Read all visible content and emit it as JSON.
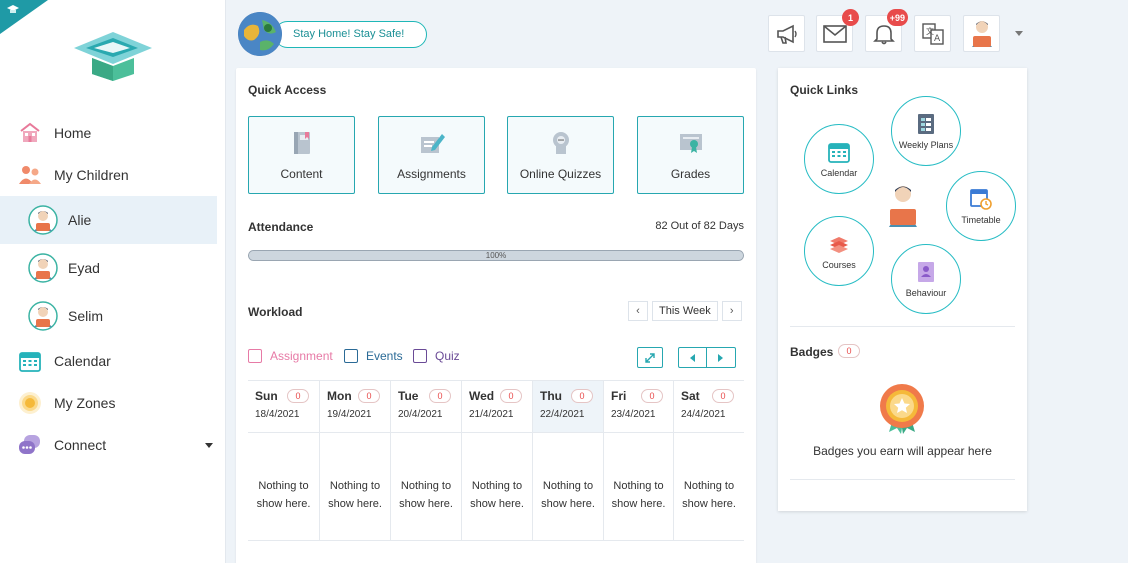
{
  "header": {
    "stay_home": "Stay Home! Stay Safe!",
    "messages_count": "1",
    "notifications_count": "+99"
  },
  "sidebar": {
    "items": [
      {
        "label": "Home",
        "icon": "home-icon"
      },
      {
        "label": "My Children",
        "icon": "children-icon"
      }
    ],
    "children": [
      {
        "label": "Alie",
        "active": true
      },
      {
        "label": "Eyad",
        "active": false
      },
      {
        "label": "Selim",
        "active": false
      }
    ],
    "items2": [
      {
        "label": "Calendar",
        "icon": "calendar-icon"
      },
      {
        "label": "My Zones",
        "icon": "zones-icon"
      },
      {
        "label": "Connect",
        "icon": "connect-icon"
      }
    ]
  },
  "main": {
    "quick_access_title": "Quick Access",
    "tiles": [
      {
        "label": "Content",
        "icon": "book-icon"
      },
      {
        "label": "Assignments",
        "icon": "assignment-icon"
      },
      {
        "label": "Online Quizzes",
        "icon": "quiz-icon"
      },
      {
        "label": "Grades",
        "icon": "certificate-icon"
      }
    ],
    "attendance_title": "Attendance",
    "attendance_summary": "82 Out of 82 Days",
    "attendance_percent_label": "100%",
    "attendance_fraction": 1.0,
    "workload_title": "Workload",
    "this_week": "This Week",
    "filters": [
      {
        "label": "Assignment",
        "color": "#e77aa6"
      },
      {
        "label": "Events",
        "color": "#2a6a96"
      },
      {
        "label": "Quiz",
        "color": "#6a4a96"
      }
    ],
    "days": [
      {
        "name": "Sun",
        "date": "18/4/2021",
        "count": "0",
        "empty1": "Nothing to",
        "empty2": "show here."
      },
      {
        "name": "Mon",
        "date": "19/4/2021",
        "count": "0",
        "empty1": "Nothing to",
        "empty2": "show here."
      },
      {
        "name": "Tue",
        "date": "20/4/2021",
        "count": "0",
        "empty1": "Nothing to",
        "empty2": "show here."
      },
      {
        "name": "Wed",
        "date": "21/4/2021",
        "count": "0",
        "empty1": "Nothing to",
        "empty2": "show here."
      },
      {
        "name": "Thu",
        "date": "22/4/2021",
        "count": "0",
        "empty1": "Nothing to",
        "empty2": "show here.",
        "today": true
      },
      {
        "name": "Fri",
        "date": "23/4/2021",
        "count": "0",
        "empty1": "Nothing to",
        "empty2": "show here."
      },
      {
        "name": "Sat",
        "date": "24/4/2021",
        "count": "0",
        "empty1": "Nothing to",
        "empty2": "show here."
      }
    ]
  },
  "quick_links": {
    "title": "Quick Links",
    "items": [
      {
        "label": "Weekly Plans"
      },
      {
        "label": "Calendar"
      },
      {
        "label": "Timetable"
      },
      {
        "label": "Courses"
      },
      {
        "label": "Behaviour"
      }
    ]
  },
  "badges": {
    "title": "Badges",
    "count": "0",
    "empty_text": "Badges you earn will appear here"
  },
  "colors": {
    "accent": "#26a7b0",
    "alert": "#e84b4b"
  }
}
